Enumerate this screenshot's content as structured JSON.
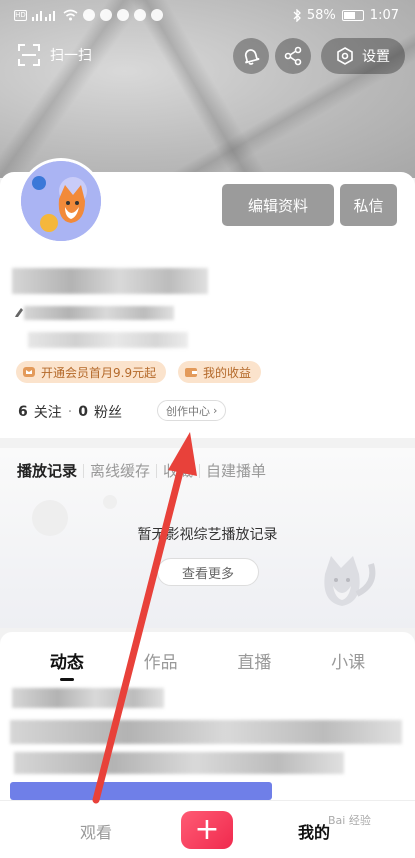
{
  "status_bar": {
    "hd": "HD",
    "battery": "58%",
    "time": "1:07"
  },
  "top_bar": {
    "scan_label": "扫一扫",
    "settings_label": "设置"
  },
  "profile": {
    "edit_button": "编辑资料",
    "message_button": "私信",
    "vip_label": "开通会员首月9.9元起",
    "earnings_label": "我的收益",
    "following_count": "6",
    "following_label": "关注",
    "followers_count": "0",
    "followers_label": "粉丝",
    "creator_center": "创作中心"
  },
  "history": {
    "tabs": [
      "播放记录",
      "离线缓存",
      "收藏",
      "自建播单"
    ],
    "empty_text": "暂无影视综艺播放记录",
    "more_button": "查看更多"
  },
  "feed": {
    "tabs": [
      "动态",
      "作品",
      "直播",
      "小课"
    ]
  },
  "bottom_nav": {
    "watch": "观看",
    "add": "+",
    "mine": "我的"
  },
  "watermark": "Bai 经验"
}
